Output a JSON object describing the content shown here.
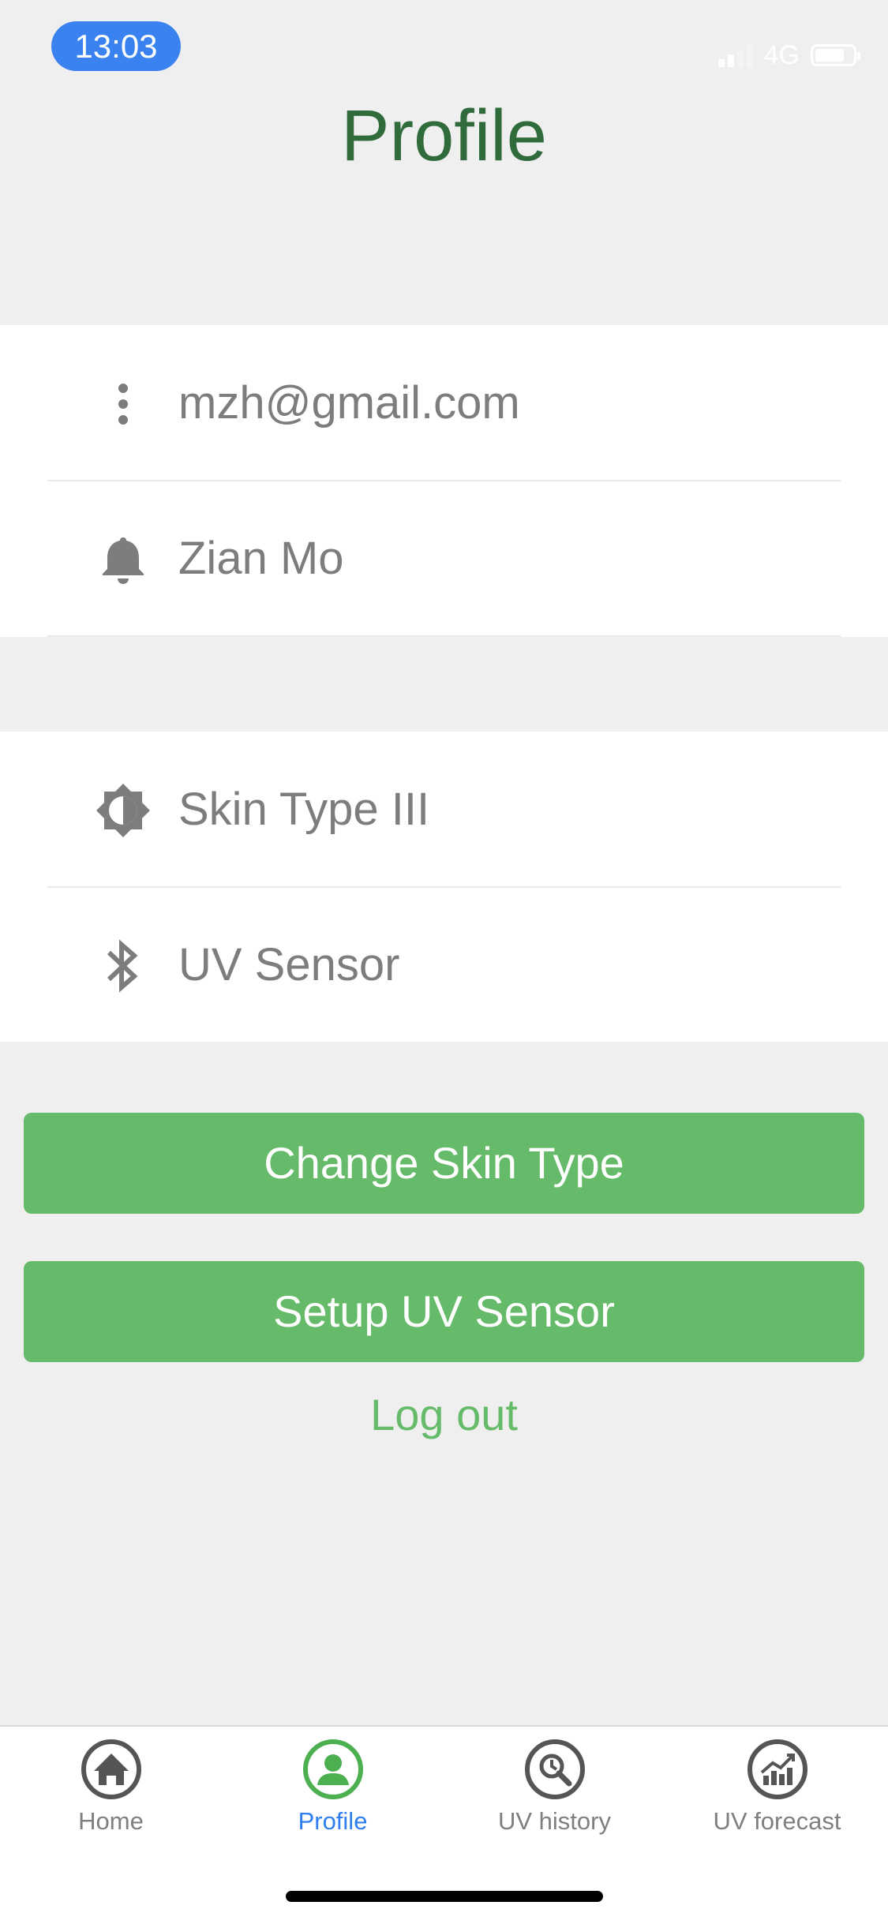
{
  "status": {
    "time": "13:03",
    "network": "4G"
  },
  "title": "Profile",
  "account": {
    "email": "mzh@gmail.com",
    "name": "Zian Mo"
  },
  "settings": {
    "skin_type": "Skin Type III",
    "sensor": "UV Sensor"
  },
  "buttons": {
    "change_skin": "Change Skin Type",
    "setup_sensor": "Setup UV Sensor",
    "logout": "Log out"
  },
  "tabs": [
    {
      "label": "Home",
      "icon": "home-icon"
    },
    {
      "label": "Profile",
      "icon": "person-icon",
      "active": true
    },
    {
      "label": "UV history",
      "icon": "history-search-icon"
    },
    {
      "label": "UV forecast",
      "icon": "trend-chart-icon"
    }
  ],
  "colors": {
    "accent_green": "#66bb6a",
    "title_green": "#2f6b3b",
    "active_blue": "#2f7ef0",
    "time_pill": "#3a82f0"
  }
}
